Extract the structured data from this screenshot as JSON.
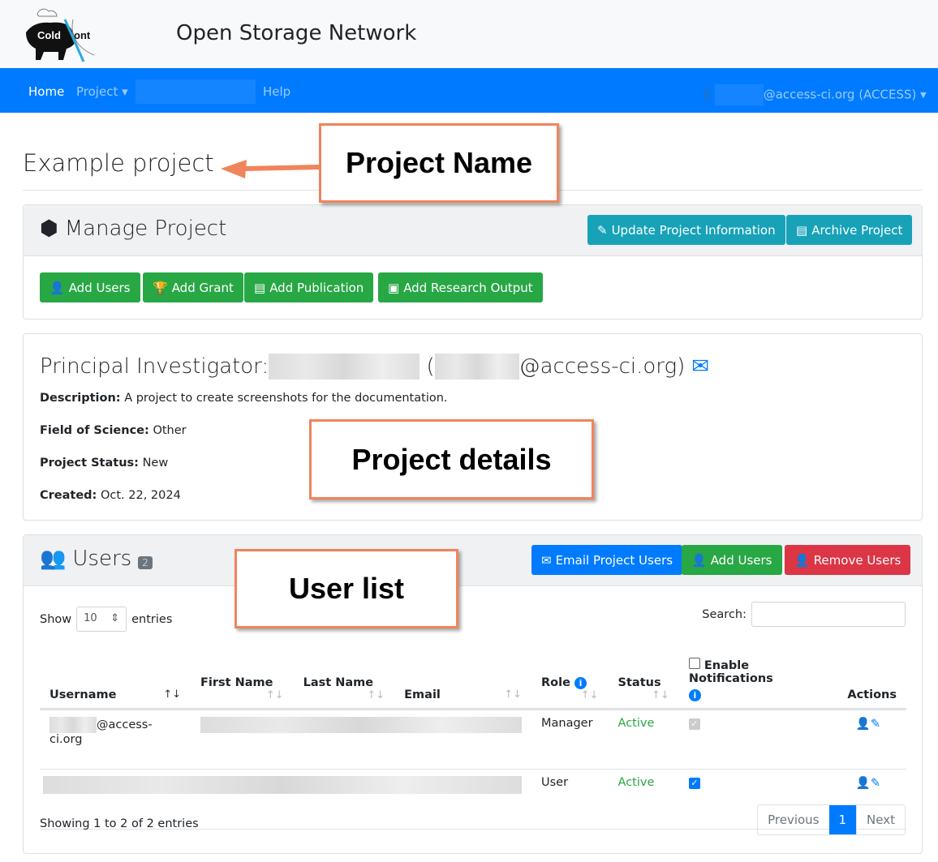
{
  "header": {
    "logo_text": "ColdFront",
    "site_title": "Open Storage Network"
  },
  "nav": {
    "home": "Home",
    "project": "Project",
    "help": "Help",
    "user": "@access-ci.org (ACCESS)"
  },
  "page": {
    "title": "Example project"
  },
  "manage": {
    "title": "Manage Project",
    "update": "Update Project Information",
    "archive": "Archive Project",
    "add_users": "Add Users",
    "add_grant": "Add Grant",
    "add_publication": "Add Publication",
    "add_research_output": "Add Research Output"
  },
  "details": {
    "pi_label": "Principal Investigator:",
    "pi_email_suffix": "@access-ci.org)",
    "pi_paren": "(",
    "description_label": "Description:",
    "description": "A project to create screenshots for the documentation.",
    "field_label": "Field of Science:",
    "field": "Other",
    "status_label": "Project Status:",
    "status": "New",
    "created_label": "Created:",
    "created": "Oct. 22, 2024"
  },
  "users": {
    "title": "Users",
    "count": "2",
    "email": "Email Project Users",
    "add": "Add Users",
    "remove": "Remove Users",
    "show": "Show",
    "entries": "entries",
    "page_size": "10",
    "search_label": "Search:",
    "columns": [
      "Username",
      "First Name",
      "Last Name",
      "Email",
      "Role",
      "Status",
      "Enable Notifications",
      "Actions"
    ],
    "rows": [
      {
        "username": "@access-ci.org",
        "role": "Manager",
        "status": "Active",
        "notify": true,
        "notify_disabled": true
      },
      {
        "username": "",
        "role": "User",
        "status": "Active",
        "notify": true,
        "notify_disabled": false
      }
    ],
    "info": "Showing 1 to 2 of 2 entries",
    "prev": "Previous",
    "page": "1",
    "next": "Next"
  },
  "callouts": {
    "name": "Project Name",
    "details": "Project details",
    "users": "User list"
  },
  "colors": {
    "nav": "#007bff",
    "info": "#17a2b8",
    "success": "#28a745",
    "danger": "#dc3545",
    "callout_border": "#f0845c"
  }
}
